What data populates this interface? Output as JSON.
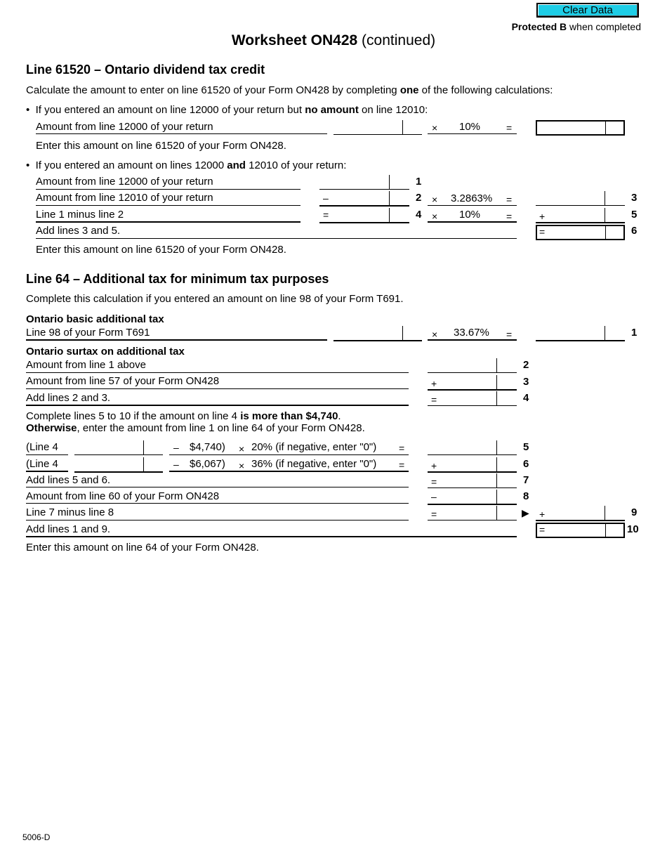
{
  "header": {
    "clear_button": "Clear Data",
    "protected_bold": "Protected B",
    "protected_rest": " when completed",
    "title_bold": "Worksheet ON428",
    "title_rest": " (continued)"
  },
  "section1": {
    "heading": "Line 61520 – Ontario dividend tax credit",
    "intro_pre": "Calculate the amount to enter on line 61520 of your Form ON428 by completing ",
    "intro_bold": "one",
    "intro_post": " of the following calculations:",
    "caseA": {
      "bullet_pre": "If you entered an amount on line 12000 of your return but ",
      "bullet_bold": "no amount",
      "bullet_post": " on line 12010:",
      "row_label": "Amount from line 12000 of your return",
      "times": "×",
      "rate": "10%",
      "equals": "=",
      "note": "Enter this amount on line 61520 of your Form ON428."
    },
    "caseB": {
      "bullet_pre": "If you entered an amount on lines 12000 ",
      "bullet_bold": "and",
      "bullet_post": " 12010 of your return:",
      "rows": [
        {
          "label": "Amount from line 12000 of your return",
          "op": "",
          "line": "1"
        },
        {
          "label": "Amount from line 12010 of your return",
          "op": "–",
          "line": "2",
          "times": "×",
          "rate": "3.2863%",
          "equals": "=",
          "result_op": "",
          "result_line": "3"
        },
        {
          "label": "Line 1 minus line 2",
          "op": "=",
          "line": "4",
          "times": "×",
          "rate": "10%",
          "equals": "=",
          "result_op": "+",
          "result_line": "5"
        },
        {
          "label": "Add lines 3 and 5.",
          "result_op": "=",
          "result_line": "6"
        }
      ],
      "note": "Enter this amount on line 61520 of your Form ON428."
    }
  },
  "section2": {
    "heading": "Line 64 – Additional tax for minimum tax purposes",
    "intro": "Complete this calculation if you entered an amount on line 98 of your Form T691.",
    "basic": {
      "subheading": "Ontario basic additional tax",
      "label": "Line 98 of your Form T691",
      "times": "×",
      "rate": "33.67%",
      "equals": "=",
      "line": "1"
    },
    "surtax": {
      "subheading": "Ontario surtax on additional tax",
      "rows": [
        {
          "label": "Amount from line 1 above",
          "op": "",
          "line": "2"
        },
        {
          "label": "Amount from line 57 of your Form ON428",
          "op": "+",
          "line": "3"
        },
        {
          "label": "Add lines 2 and 3.",
          "op": "=",
          "line": "4"
        }
      ],
      "cond1_pre": "Complete lines 5 to 10 if the amount on line 4 ",
      "cond1_bold": "is more than $4,740",
      "cond1_post": ".",
      "cond2_bold": "Otherwise",
      "cond2_post": ", enter the amount from line 1 on line 64 of your Form ON428.",
      "calc_rows": [
        {
          "label": "(Line 4",
          "minus": "–",
          "threshold": "$4,740)",
          "times": "×",
          "rate_text": "20% (if negative, enter \"0\")",
          "equals": "=",
          "op": "",
          "line": "5"
        },
        {
          "label": "(Line 4",
          "minus": "–",
          "threshold": "$6,067)",
          "times": "×",
          "rate_text": "36% (if negative, enter \"0\")",
          "equals": "=",
          "op": "+",
          "line": "6"
        }
      ],
      "rows2": [
        {
          "label": "Add lines 5 and 6.",
          "op": "=",
          "line": "7"
        },
        {
          "label": "Amount from line 60 of your Form ON428",
          "op": "–",
          "line": "8"
        },
        {
          "label": "Line 7 minus line 8",
          "op": "=",
          "line": "",
          "arrow": "▶",
          "result_op": "+",
          "result_line": "9"
        },
        {
          "label": "Add lines 1 and 9.",
          "result_op": "=",
          "result_line": "10"
        }
      ],
      "note": "Enter this amount on line 64 of your Form ON428."
    }
  },
  "footer": {
    "form_code": "5006-D"
  }
}
